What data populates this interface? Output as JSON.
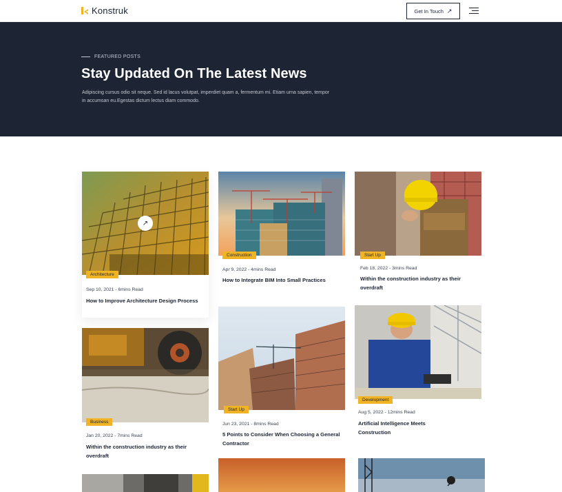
{
  "header": {
    "brand": "Konstruk",
    "cta_label": "Get In Touch",
    "cta_icon": "arrow-up-right-icon",
    "menu_icon": "hamburger-menu-icon"
  },
  "hero": {
    "eyebrow": "FEATURED POSTS",
    "title": "Stay Updated On The Latest News",
    "description": "Adipiscing cursus odio sit neque. Sed id lacus volutpat, imperdiet quam a, fermentum mi. Etiam urna sapien, tempor in accumsan eu.Egestas dictum lectus diam commodo."
  },
  "posts": [
    {
      "tag": "Architecture",
      "meta": "Sep 10, 2021 - 6mins Read",
      "title": "How to Improve Architecture Design Process"
    },
    {
      "tag": "Construction",
      "meta": "Apr 9, 2022 - 4mins Read",
      "title": "How to Integrate BIM Into Small Practices"
    },
    {
      "tag": "Start Up",
      "meta": "Feb 18, 2022 - 3mins Read",
      "title": "Within the construction industry as their overdraft"
    },
    {
      "tag": "Business",
      "meta": "Jan 20, 2022 - 7mins Read",
      "title": "Within the construction industry as their overdraft"
    },
    {
      "tag": "Start Up",
      "meta": "Jun 23, 2021 - 8mins Read",
      "title": "5 Points to Consider When Choosing a General Contractor"
    },
    {
      "tag": "Development",
      "meta": "Aug 5, 2022 - 12mins Read",
      "title": "Artificial Intelligence Meets Construction"
    }
  ],
  "colors": {
    "accent": "#f0b323",
    "hero_bg": "#1d2434",
    "text": "#1c2233"
  }
}
